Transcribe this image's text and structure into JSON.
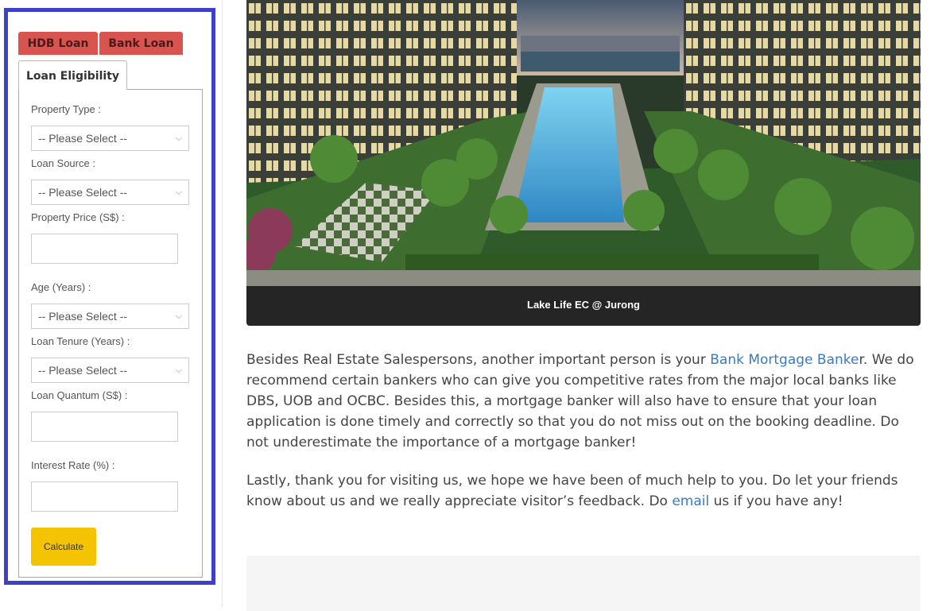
{
  "sidebar": {
    "tabs": {
      "hdb_loan": "HDB Loan",
      "bank_loan": "Bank Loan",
      "loan_eligibility": "Loan Eligibility"
    },
    "form": {
      "property_type_label": "Property Type :",
      "property_type_value": "-- Please Select --",
      "loan_source_label": "Loan Source :",
      "loan_source_value": "-- Please Select --",
      "property_price_label": "Property Price (S$) :",
      "age_label": "Age (Years) :",
      "age_value": "-- Please Select --",
      "loan_tenure_label": "Loan Tenure (Years) :",
      "loan_tenure_value": "-- Please Select --",
      "loan_quantum_label": "Loan Quantum (S$) :",
      "interest_rate_label": "Interest Rate (%) :",
      "calculate_label": "Calculate"
    },
    "accent_color": "#3f3fc8",
    "tab_color": "#d9534f",
    "button_color": "#f5c400"
  },
  "main": {
    "image_caption": "Lake Life EC @ Jurong",
    "paragraph1": {
      "before": "Besides Real Estate Salespersons, another important person is your ",
      "link": "Bank Mortgage Banke",
      "after": "r. We do recommend certain bankers who can give you competitive rates from the major local banks like DBS, UOB and OCBC. Besides this, a mortgage banker will also have to ensure that your loan application is done timely and correctly so that you do not miss out on the booking deadline. Do not underestimate the importance of a mortgage banker!"
    },
    "paragraph2": {
      "before": "Lastly, thank you for visiting us, we hope we have been of much help to you. Do let your friends know about us and we really appreciate visitor’s feedback. Do ",
      "link": "email",
      "after": " us if you have any!"
    },
    "link_color": "#3a7bbf"
  }
}
